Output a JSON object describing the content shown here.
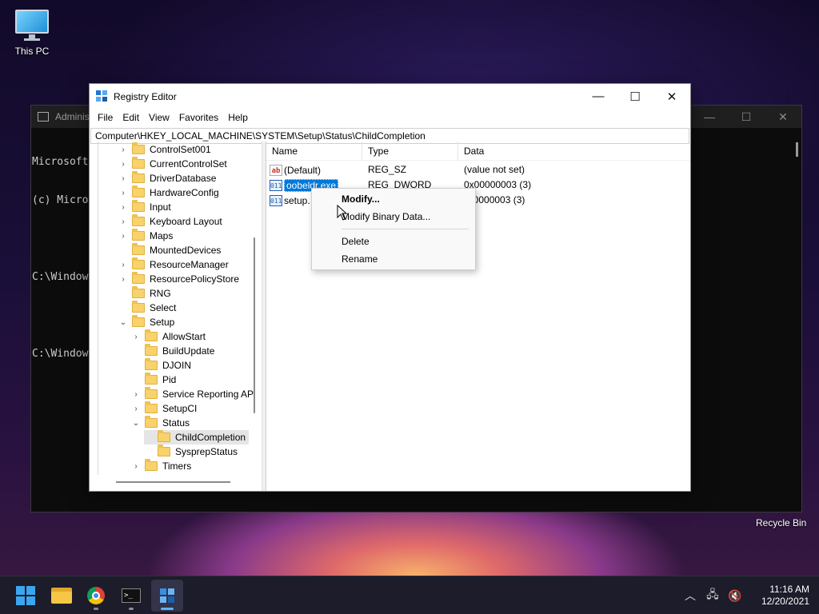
{
  "desktop": {
    "this_pc_label": "This PC",
    "recycle_bin_label": "Recycle Bin"
  },
  "console": {
    "title": "Adminis",
    "lines": [
      "Microsoft",
      "(c) Micro",
      "",
      "C:\\Window",
      "",
      "C:\\Window"
    ]
  },
  "window": {
    "title": "Registry Editor",
    "minimize": "—",
    "maximize": "☐",
    "close": "✕",
    "menu": [
      "File",
      "Edit",
      "View",
      "Favorites",
      "Help"
    ],
    "address": "Computer\\HKEY_LOCAL_MACHINE\\SYSTEM\\Setup\\Status\\ChildCompletion"
  },
  "tree": [
    {
      "label": "ControlSet001",
      "chevron": "›",
      "level": 0
    },
    {
      "label": "CurrentControlSet",
      "chevron": "›",
      "level": 0
    },
    {
      "label": "DriverDatabase",
      "chevron": "›",
      "level": 0
    },
    {
      "label": "HardwareConfig",
      "chevron": "›",
      "level": 0
    },
    {
      "label": "Input",
      "chevron": "›",
      "level": 0
    },
    {
      "label": "Keyboard Layout",
      "chevron": "›",
      "level": 0
    },
    {
      "label": "Maps",
      "chevron": "›",
      "level": 0
    },
    {
      "label": "MountedDevices",
      "chevron": "",
      "level": 0
    },
    {
      "label": "ResourceManager",
      "chevron": "›",
      "level": 0
    },
    {
      "label": "ResourcePolicyStore",
      "chevron": "›",
      "level": 0
    },
    {
      "label": "RNG",
      "chevron": "",
      "level": 0
    },
    {
      "label": "Select",
      "chevron": "",
      "level": 0
    },
    {
      "label": "Setup",
      "chevron": "⌄",
      "level": 0
    },
    {
      "label": "AllowStart",
      "chevron": "›",
      "level": 1
    },
    {
      "label": "BuildUpdate",
      "chevron": "",
      "level": 1
    },
    {
      "label": "DJOIN",
      "chevron": "",
      "level": 1
    },
    {
      "label": "Pid",
      "chevron": "",
      "level": 1
    },
    {
      "label": "Service Reporting AP",
      "chevron": "›",
      "level": 1
    },
    {
      "label": "SetupCI",
      "chevron": "›",
      "level": 1
    },
    {
      "label": "Status",
      "chevron": "⌄",
      "level": 1
    },
    {
      "label": "ChildCompletion",
      "chevron": "",
      "level": 2,
      "selected": true
    },
    {
      "label": "SysprepStatus",
      "chevron": "",
      "level": 2
    },
    {
      "label": "Timers",
      "chevron": "›",
      "level": 1
    }
  ],
  "list": {
    "headers": {
      "name": "Name",
      "type": "Type",
      "data": "Data"
    },
    "rows": [
      {
        "icon": "ab",
        "icon_kind": "string-value-icon",
        "name": "(Default)",
        "type": "REG_SZ",
        "data": "(value not set)"
      },
      {
        "icon": "011",
        "icon_kind": "binary-value-icon",
        "name": "oobeldr.exe",
        "type": "REG_DWORD",
        "data": "0x00000003 (3)",
        "editing": true
      },
      {
        "icon": "011",
        "icon_kind": "binary-value-icon",
        "name": "setup.",
        "type": "",
        "data": "00000003 (3)"
      }
    ]
  },
  "context_menu": {
    "items": [
      "Modify...",
      "Modify Binary Data...",
      "Delete",
      "Rename"
    ]
  },
  "taskbar": {
    "console_glyph": ">_",
    "tray": {
      "chevron": "︿",
      "network": "🖧",
      "volume": "🔇"
    },
    "time": "11:16 AM",
    "date": "12/20/2021"
  }
}
